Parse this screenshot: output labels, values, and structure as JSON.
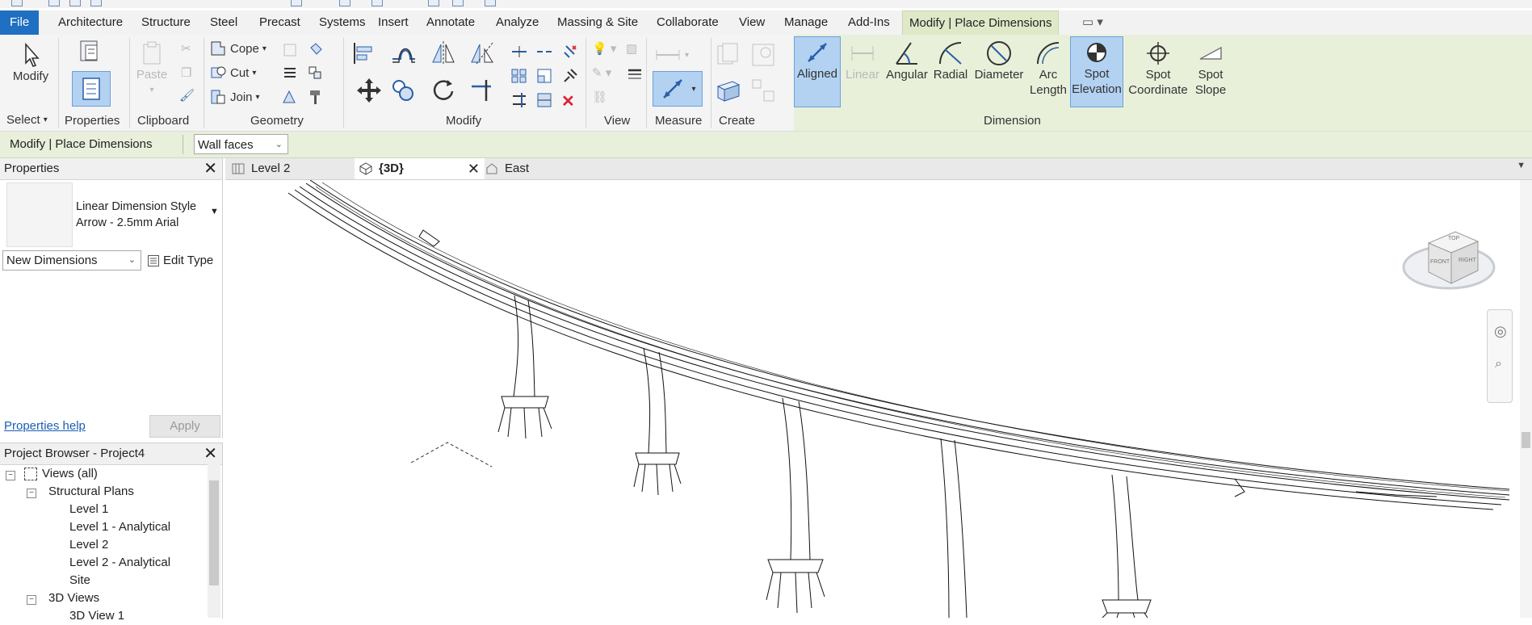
{
  "menu": {
    "file": "File",
    "tabs": [
      "Architecture",
      "Structure",
      "Steel",
      "Precast",
      "Systems",
      "Insert",
      "Annotate",
      "Analyze",
      "Massing & Site",
      "Collaborate",
      "View",
      "Manage",
      "Add-Ins",
      "Modify | Place Dimensions"
    ],
    "active_tab": "Modify | Place Dimensions"
  },
  "ribbon": {
    "select": {
      "modify": "Modify",
      "panel": "Select"
    },
    "properties": {
      "panel": "Properties"
    },
    "clipboard": {
      "paste": "Paste",
      "panel": "Clipboard"
    },
    "geometry": {
      "cope": "Cope",
      "cut": "Cut",
      "join": "Join",
      "panel": "Geometry"
    },
    "modify": {
      "panel": "Modify"
    },
    "view": {
      "panel": "View"
    },
    "measure": {
      "panel": "Measure"
    },
    "create": {
      "panel": "Create"
    },
    "dimension": {
      "panel": "Dimension",
      "aligned": "Aligned",
      "linear": "Linear",
      "angular": "Angular",
      "radial": "Radial",
      "diameter": "Diameter",
      "arc_length_1": "Arc",
      "arc_length_2": "Length",
      "spot_elevation_1": "Spot",
      "spot_elevation_2": "Elevation",
      "spot_coordinate_1": "Spot",
      "spot_coordinate_2": "Coordinate",
      "spot_slope_1": "Spot",
      "spot_slope_2": "Slope"
    }
  },
  "options_bar": {
    "context": "Modify | Place Dimensions",
    "pick": "Wall faces"
  },
  "properties_palette": {
    "title": "Properties",
    "type_line1": "Linear Dimension Style",
    "type_line2": "Arrow - 2.5mm Arial",
    "instance": "New Dimensions",
    "edit_type": "Edit Type",
    "help": "Properties help",
    "apply": "Apply"
  },
  "project_browser": {
    "title": "Project Browser - Project4",
    "items": [
      {
        "label": "Views (all)"
      },
      {
        "label": "Structural Plans"
      },
      {
        "label": "Level 1"
      },
      {
        "label": "Level 1 - Analytical"
      },
      {
        "label": "Level 2"
      },
      {
        "label": "Level 2 - Analytical"
      },
      {
        "label": "Site"
      },
      {
        "label": "3D Views"
      },
      {
        "label": "3D View 1"
      }
    ]
  },
  "view_tabs": [
    {
      "label": "Level 2"
    },
    {
      "label": "{3D}"
    },
    {
      "label": "East"
    }
  ],
  "viewcube": {
    "top": "TOP",
    "front": "FRONT",
    "right": "RIGHT"
  },
  "colors": {
    "file_tab": "#1f6fc2",
    "context_ribbon": "#e9f0da",
    "selected_button": "#b3d2f2"
  }
}
